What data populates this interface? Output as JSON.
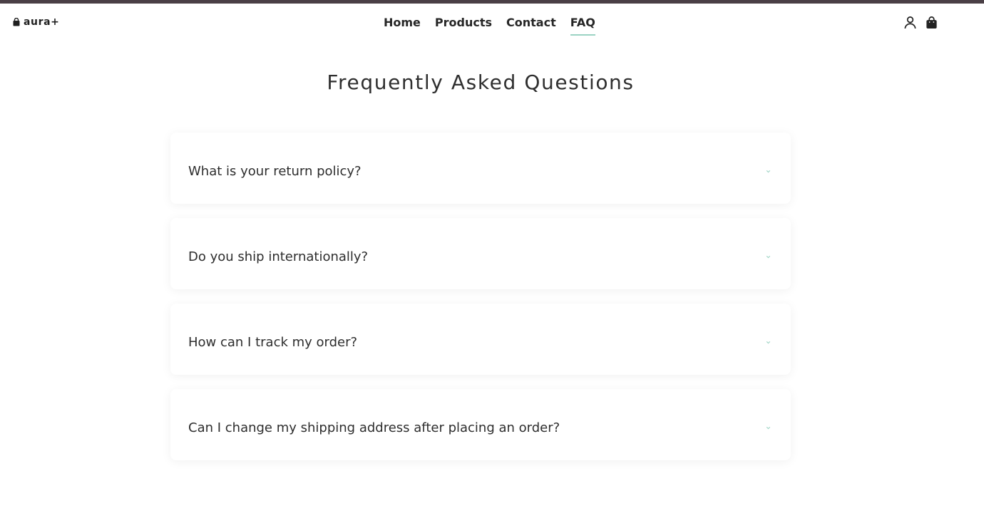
{
  "brand": {
    "name": "aura+",
    "logo_icon": "shopping-bag-icon",
    "accent_color": "#9bd3c3",
    "top_bar_color": "#4a3f46"
  },
  "nav": {
    "items": [
      {
        "label": "Home",
        "active": false
      },
      {
        "label": "Products",
        "active": false
      },
      {
        "label": "Contact",
        "active": false
      },
      {
        "label": "FAQ",
        "active": true
      }
    ]
  },
  "header_icons": [
    {
      "icon": "user-icon"
    },
    {
      "icon": "shopping-bag-icon"
    }
  ],
  "page": {
    "title": "Frequently Asked Questions"
  },
  "faq": {
    "questions": [
      {
        "question": "What is your return policy?",
        "expanded": false
      },
      {
        "question": "Do you ship internationally?",
        "expanded": false
      },
      {
        "question": "How can I track my order?",
        "expanded": false
      },
      {
        "question": "Can I change my shipping address after placing an order?",
        "expanded": false
      }
    ]
  }
}
